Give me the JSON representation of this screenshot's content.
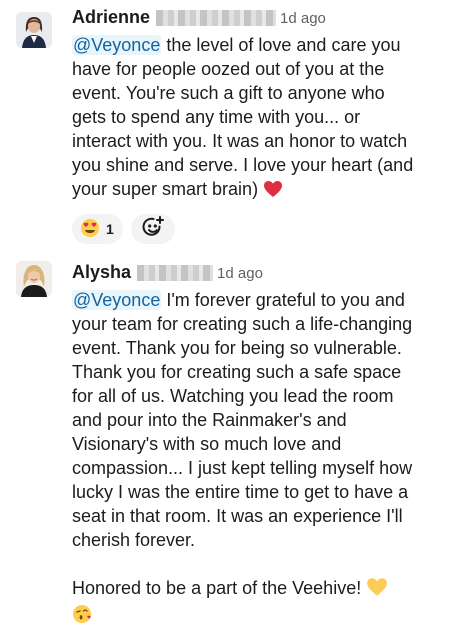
{
  "messages": [
    {
      "author": "Adrienne",
      "timestamp": "1d ago",
      "mention": "@Veyonce",
      "text": " the level of love and care you\nhave for people oozed out of you at the\nevent. You're such a gift to anyone who\ngets to spend any time with you... or\ninteract with you. It was an honor to watch\nyou shine and serve. I love your heart (and\nyour super smart brain)",
      "trailing_emoji": "red-heart",
      "reactions": [
        {
          "emoji": "heart-eyes-face",
          "count": "1"
        }
      ]
    },
    {
      "author": "Alysha",
      "timestamp": "1d ago",
      "mention": "@Veyonce",
      "text": " I'm forever grateful to you and\nyour team for creating such a life-changing\nevent. Thank you for being so vulnerable.\nThank you for creating such a safe space\nfor all of us. Watching you lead the room\nand pour into the Rainmaker's and\nVisionary's with so much love and\ncompassion... I just kept telling myself how\nlucky I was the entire time to get to have a\nseat in that room. It was an experience I'll\ncherish forever.\n\nHonored to be a part of the Veehive!",
      "trailing_emoji": "yellow-heart",
      "extra_emoji": "face-blowing-kiss"
    }
  ],
  "colors": {
    "mention": "#1264a3",
    "mention_bg": "#e8f5fa",
    "text": "#1d1c1d",
    "timestamp": "#616061",
    "reaction_bg": "#f3f3f3"
  }
}
